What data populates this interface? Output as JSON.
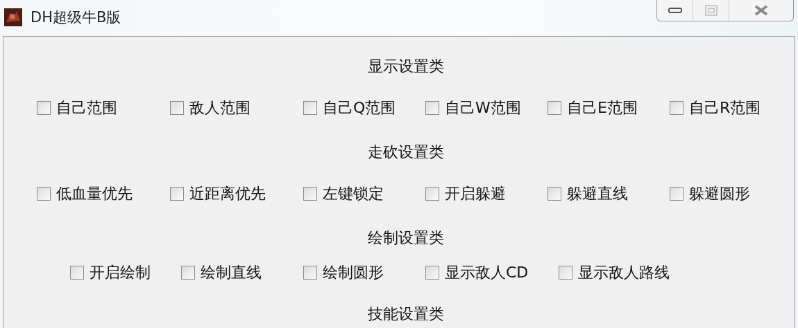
{
  "window": {
    "title": "DH超级牛B版"
  },
  "sections": [
    {
      "heading": "显示设置类",
      "options": [
        {
          "label": "自己范围",
          "checked": false
        },
        {
          "label": "敌人范围",
          "checked": false
        },
        {
          "label": "自己Q范围",
          "checked": false
        },
        {
          "label": "自己W范围",
          "checked": false
        },
        {
          "label": "自己E范围",
          "checked": false
        },
        {
          "label": "自己R范围",
          "checked": false
        }
      ]
    },
    {
      "heading": "走砍设置类",
      "options": [
        {
          "label": "低血量优先",
          "checked": false
        },
        {
          "label": "近距离优先",
          "checked": false
        },
        {
          "label": "左键锁定",
          "checked": false
        },
        {
          "label": "开启躲避",
          "checked": false
        },
        {
          "label": "躲避直线",
          "checked": false
        },
        {
          "label": "躲避圆形",
          "checked": false
        }
      ]
    },
    {
      "heading": "绘制设置类",
      "options": [
        {
          "label": "开启绘制",
          "checked": false
        },
        {
          "label": "绘制直线",
          "checked": false
        },
        {
          "label": "绘制圆形",
          "checked": false
        },
        {
          "label": "显示敌人CD",
          "checked": false
        },
        {
          "label": "显示敌人路线",
          "checked": false
        }
      ]
    },
    {
      "heading": "技能设置类"
    }
  ]
}
